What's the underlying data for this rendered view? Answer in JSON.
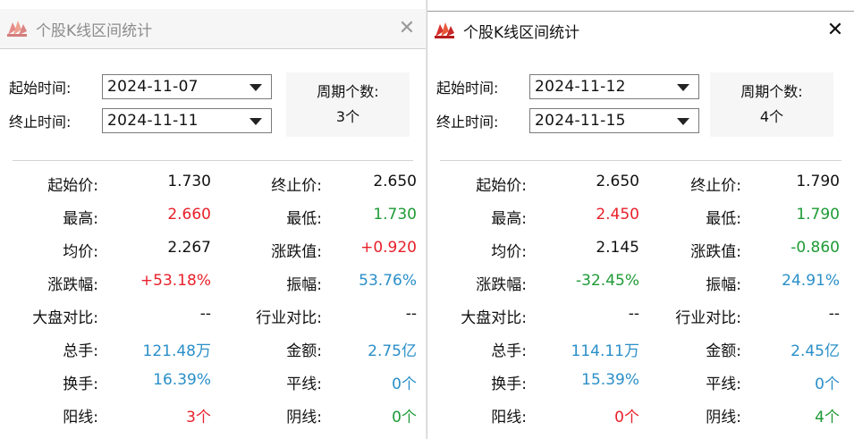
{
  "colors": {
    "red": "#e8202a",
    "green": "#1e9a36",
    "blue": "#2a8fc8",
    "black": "#111111"
  },
  "panels": [
    {
      "title": "个股K线区间统计",
      "close_icon": "✕",
      "start_label": "起始时间:",
      "start_date": "2024-11-07",
      "end_label": "终止时间:",
      "end_date": "2024-11-11",
      "period_label": "周期个数:",
      "period_value": "3个",
      "rows": [
        {
          "l0": "起始价:",
          "v0": "1.730",
          "c0": "black",
          "l1": "终止价:",
          "v1": "2.650",
          "c1": "black"
        },
        {
          "l0": "最高:",
          "v0": "2.660",
          "c0": "red",
          "l1": "最低:",
          "v1": "1.730",
          "c1": "green"
        },
        {
          "l0": "均价:",
          "v0": "2.267",
          "c0": "black",
          "l1": "涨跌值:",
          "v1": "+0.920",
          "c1": "red"
        },
        {
          "l0": "涨跌幅:",
          "v0": "+53.18%",
          "c0": "red",
          "l1": "振幅:",
          "v1": "53.76%",
          "c1": "blue"
        },
        {
          "l0": "大盘对比:",
          "v0": "--",
          "c0": "black",
          "l1": "行业对比:",
          "v1": "--",
          "c1": "black"
        },
        {
          "l0": "总手:",
          "v0": "121.48万",
          "c0": "blue",
          "l1": "金额:",
          "v1": "2.75亿",
          "c1": "blue"
        },
        {
          "l0": "换手:",
          "v0": "16.39%",
          "c0": "blue",
          "l1": "平线:",
          "v1": "0个",
          "c1": "blue"
        },
        {
          "l0": "阳线:",
          "v0": "3个",
          "c0": "red",
          "l1": "阴线:",
          "v1": "0个",
          "c1": "green"
        }
      ]
    },
    {
      "title": "个股K线区间统计",
      "close_icon": "✕",
      "start_label": "起始时间:",
      "start_date": "2024-11-12",
      "end_label": "终止时间:",
      "end_date": "2024-11-15",
      "period_label": "周期个数:",
      "period_value": "4个",
      "rows": [
        {
          "l0": "起始价:",
          "v0": "2.650",
          "c0": "black",
          "l1": "终止价:",
          "v1": "1.790",
          "c1": "black"
        },
        {
          "l0": "最高:",
          "v0": "2.450",
          "c0": "red",
          "l1": "最低:",
          "v1": "1.790",
          "c1": "green"
        },
        {
          "l0": "均价:",
          "v0": "2.145",
          "c0": "black",
          "l1": "涨跌值:",
          "v1": "-0.860",
          "c1": "green"
        },
        {
          "l0": "涨跌幅:",
          "v0": "-32.45%",
          "c0": "green",
          "l1": "振幅:",
          "v1": "24.91%",
          "c1": "blue"
        },
        {
          "l0": "大盘对比:",
          "v0": "--",
          "c0": "black",
          "l1": "行业对比:",
          "v1": "--",
          "c1": "black"
        },
        {
          "l0": "总手:",
          "v0": "114.11万",
          "c0": "blue",
          "l1": "金额:",
          "v1": "2.45亿",
          "c1": "blue"
        },
        {
          "l0": "换手:",
          "v0": "15.39%",
          "c0": "blue",
          "l1": "平线:",
          "v1": "0个",
          "c1": "blue"
        },
        {
          "l0": "阳线:",
          "v0": "0个",
          "c0": "red",
          "l1": "阴线:",
          "v1": "4个",
          "c1": "green"
        }
      ]
    }
  ]
}
